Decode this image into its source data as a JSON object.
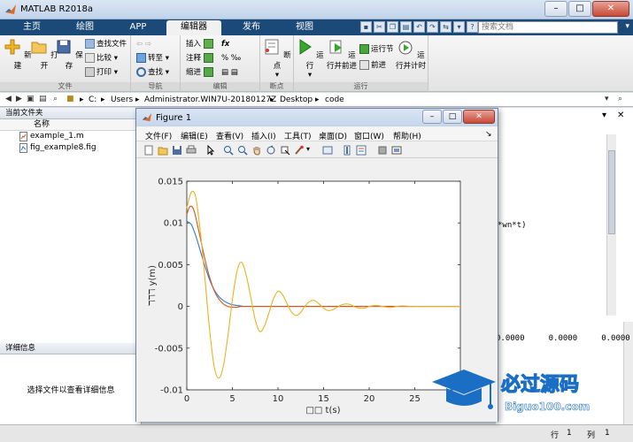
{
  "app": {
    "title": "MATLAB R2018a",
    "tabs": [
      {
        "label": "主页"
      },
      {
        "label": "绘图"
      },
      {
        "label": "APP"
      },
      {
        "label": "编辑器"
      },
      {
        "label": "发布"
      },
      {
        "label": "视图"
      }
    ],
    "active_tab": "编辑器",
    "search_placeholder": "搜索文档"
  },
  "ribbon": {
    "file": {
      "section_label": "文件",
      "new": "新建",
      "open": "打开",
      "save": "保存",
      "find_files": "查找文件",
      "compare": "比较",
      "print": "打印"
    },
    "navigate": {
      "section_label": "导航",
      "goto": "转至",
      "find": "查找"
    },
    "edit": {
      "section_label": "编辑",
      "insert": "插入",
      "comment": "注释",
      "indent": "缩进",
      "fx": "fx"
    },
    "breakpoints": {
      "section_label": "断点",
      "breakpoints": "断点"
    },
    "run": {
      "section_label": "运行",
      "run": "运行",
      "run_advance": "运行并前进",
      "run_section": "运行节",
      "advance": "前进",
      "run_time": "运行并计时"
    }
  },
  "path": {
    "segments": [
      "C:",
      "Users",
      "Administrator.WIN7U-20180127Z",
      "Desktop",
      "code"
    ]
  },
  "current_folder": {
    "header": "当前文件夹",
    "column_name": "名称",
    "files": [
      {
        "name": "example_1.m"
      },
      {
        "name": "fig_example8.fig"
      }
    ],
    "details_header": "详细信息",
    "details_message": "选择文件以查看详细信息"
  },
  "workspace": {
    "code_fragment": "*wn*t)",
    "values": [
      "0.0000",
      "0.0000",
      "0.0000"
    ]
  },
  "status": {
    "row_label": "行",
    "row": "1",
    "col_label": "列",
    "col": "1"
  },
  "figure": {
    "title": "Figure 1",
    "menu": [
      "文件(F)",
      "编辑(E)",
      "查看(V)",
      "插入(I)",
      "工具(T)",
      "桌面(D)",
      "窗口(W)",
      "帮助(H)"
    ]
  },
  "watermark": {
    "brand": "必过源码",
    "url": "Biguo100.com"
  },
  "chart_data": {
    "type": "line",
    "xlabel": "□□ t(s)",
    "ylabel": "ℸℸℸ y(m)",
    "xlim": [
      0,
      30
    ],
    "ylim": [
      -0.01,
      0.015
    ],
    "xticks": [
      0,
      5,
      10,
      15,
      20,
      25
    ],
    "yticks": [
      -0.01,
      -0.005,
      0,
      0.005,
      0.01,
      0.015
    ],
    "ytick_labels": [
      "-0.01",
      "-0.005",
      "0",
      "0.005",
      "0.01",
      "0.015"
    ],
    "grid": false,
    "colors": [
      "#2e7bd4",
      "#d95319",
      "#edb120"
    ],
    "series": [
      {
        "color": "#2e7bd4",
        "x": [
          0,
          0.5,
          1,
          1.5,
          2,
          2.5,
          3,
          3.5,
          4,
          4.5,
          5,
          6,
          8,
          30
        ],
        "y": [
          0.0102,
          0.0098,
          0.0084,
          0.0066,
          0.0048,
          0.0032,
          0.002,
          0.0012,
          0.0007,
          0.0004,
          0.0002,
          5e-05,
          0,
          0
        ]
      },
      {
        "color": "#d95319",
        "x": [
          0,
          0.25,
          0.5,
          0.75,
          1,
          1.5,
          2,
          2.5,
          3,
          3.5,
          4,
          4.5,
          5,
          5.5,
          6,
          7,
          8,
          30
        ],
        "y": [
          0.011,
          0.0118,
          0.012,
          0.0116,
          0.0106,
          0.0081,
          0.0056,
          0.0035,
          0.0019,
          0.0009,
          0.0003,
          0.0,
          -0.0001,
          -0.0001,
          0.0,
          0.0,
          0,
          0
        ]
      },
      {
        "color": "#edb120",
        "x": [
          0,
          0.3,
          0.6,
          1,
          1.5,
          2,
          2.5,
          3,
          3.5,
          4,
          4.5,
          5,
          5.5,
          6,
          6.5,
          7,
          7.5,
          8,
          8.5,
          9,
          9.5,
          10,
          10.5,
          11,
          11.5,
          12,
          12.5,
          13,
          13.5,
          14,
          14.5,
          15,
          15.5,
          16,
          16.5,
          17,
          17.5,
          18,
          18.5,
          19,
          19.5,
          20,
          20.5,
          21,
          21.5,
          22,
          22.5,
          23,
          23.5,
          24,
          24.5,
          25,
          25.5,
          26,
          27,
          28,
          29,
          30
        ],
        "y": [
          0.0118,
          0.0131,
          0.0138,
          0.013,
          0.0088,
          0.0032,
          -0.0028,
          -0.0072,
          -0.0086,
          -0.0072,
          -0.0036,
          0.0008,
          0.0042,
          0.0053,
          0.0038,
          0.0012,
          -0.0016,
          -0.003,
          -0.0024,
          -0.0008,
          0.0009,
          0.0018,
          0.0014,
          0.0003,
          -0.0007,
          -0.0011,
          -0.0007,
          0.0001,
          0.0006,
          0.0007,
          0.0003,
          -0.0002,
          -0.0005,
          -0.0004,
          -0.0001,
          0.0002,
          0.0003,
          0.0002,
          -0.0001,
          -0.0002,
          -0.0002,
          0.0,
          0.0001,
          0.0001,
          0.0,
          -0.0001,
          -0.0001,
          0.0,
          5e-05,
          5e-05,
          0.0,
          0.0,
          0.0,
          0.0,
          0,
          0,
          0,
          0
        ]
      }
    ]
  }
}
